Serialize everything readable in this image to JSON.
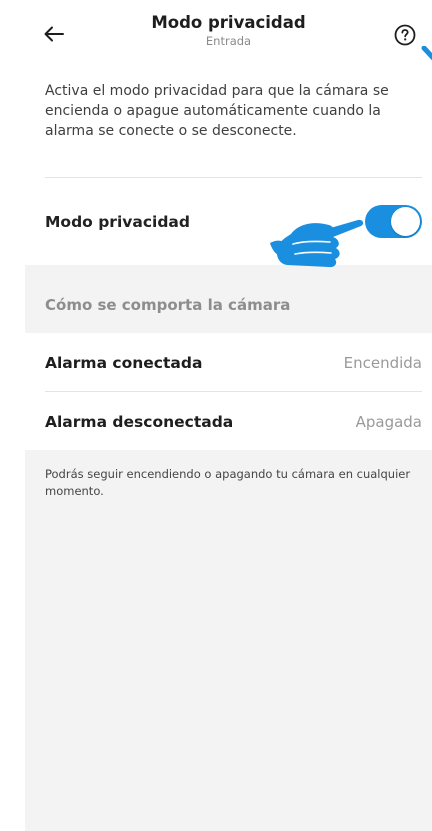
{
  "header": {
    "title": "Modo privacidad",
    "subtitle": "Entrada",
    "back_icon": "arrow-left-icon",
    "help_icon": "question-circle-icon"
  },
  "intro": {
    "text": "Activa el modo privacidad para que la cámara se encienda o apague automáticamente cuando la alarma se conecte o se desconecte."
  },
  "privacy": {
    "label": "Modo privacidad",
    "enabled": true
  },
  "section": {
    "title": "Cómo se comporta la cámara"
  },
  "rows": [
    {
      "label": "Alarma conectada",
      "value": "Encendida"
    },
    {
      "label": "Alarma desconectada",
      "value": "Apagada"
    }
  ],
  "footnote": {
    "text": "Podrás seguir encendiendo o apagando tu cámara en cualquier momento."
  },
  "colors": {
    "accent": "#1a8fe0",
    "background": "#f3f3f3",
    "secondary_text": "#9a9a9a"
  }
}
